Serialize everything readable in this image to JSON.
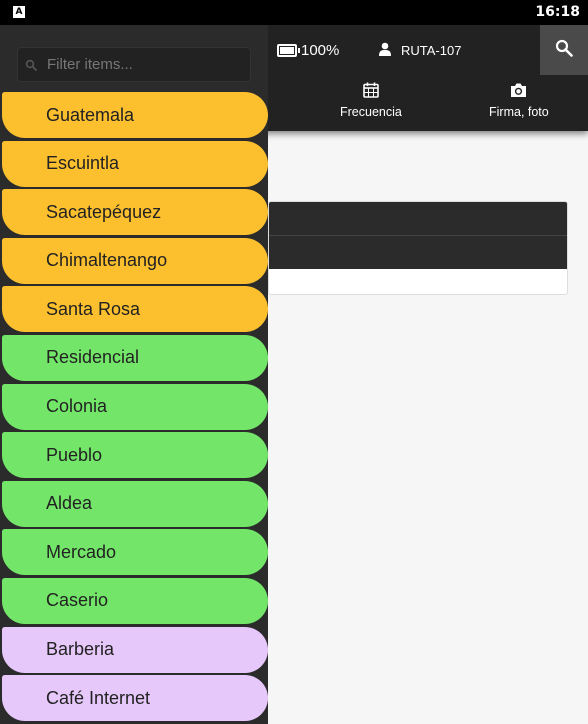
{
  "status_bar": {
    "time": "16:18",
    "app_badge": "A"
  },
  "toolbar": {
    "battery": "100%",
    "user": "RUTA-107",
    "tabs": [
      {
        "label": "Frecuencia",
        "icon": "calendar-icon"
      },
      {
        "label": "Firma, foto",
        "icon": "camera-icon"
      }
    ],
    "search_icon": "search-icon"
  },
  "drawer": {
    "filter_placeholder": "Filter items...",
    "items": [
      {
        "label": "Guatemala",
        "color": "#fcc02f"
      },
      {
        "label": "Escuintla",
        "color": "#fcc02f"
      },
      {
        "label": "Sacatepéquez",
        "color": "#fcc02f"
      },
      {
        "label": "Chimaltenango",
        "color": "#fcc02f"
      },
      {
        "label": "Santa Rosa",
        "color": "#fcc02f"
      },
      {
        "label": "Residencial",
        "color": "#73e66a"
      },
      {
        "label": "Colonia",
        "color": "#73e66a"
      },
      {
        "label": "Pueblo",
        "color": "#73e66a"
      },
      {
        "label": "Aldea",
        "color": "#73e66a"
      },
      {
        "label": "Mercado",
        "color": "#73e66a"
      },
      {
        "label": "Caserio",
        "color": "#73e66a"
      },
      {
        "label": "Barberia",
        "color": "#e6c8fa"
      },
      {
        "label": "Café Internet",
        "color": "#e6c8fa"
      }
    ]
  }
}
